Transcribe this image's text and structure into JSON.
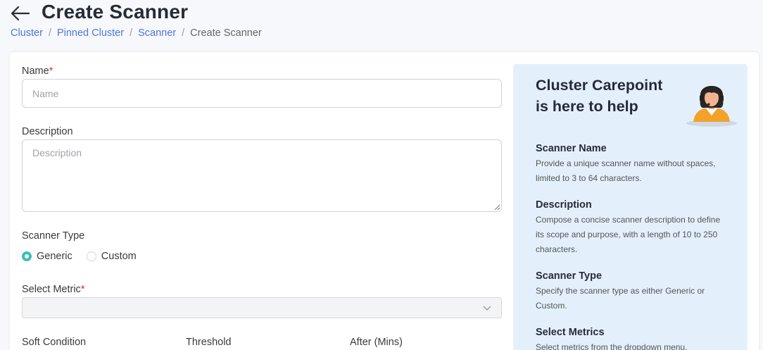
{
  "header": {
    "title": "Create Scanner",
    "breadcrumb": [
      "Cluster",
      "Pinned Cluster",
      "Scanner"
    ],
    "breadcrumb_current": "Create Scanner"
  },
  "form": {
    "name": {
      "label": "Name",
      "required": "*",
      "placeholder": "Name",
      "value": ""
    },
    "description": {
      "label": "Description",
      "placeholder": "Description",
      "value": ""
    },
    "scanner_type": {
      "label": "Scanner Type",
      "options": [
        "Generic",
        "Custom"
      ],
      "selected": "Generic"
    },
    "select_metric": {
      "label": "Select Metric",
      "required": "*",
      "value": ""
    },
    "columns": [
      "Soft Condition",
      "Threshold",
      "After (Mins)"
    ]
  },
  "help": {
    "title": "Cluster Carepoint is here to help",
    "sections": [
      {
        "heading": "Scanner Name",
        "text": "Provide a unique scanner name without spaces, limited to 3 to 64 characters."
      },
      {
        "heading": "Description",
        "text": "Compose a concise scanner description to define its scope and purpose, with a length of 10 to 250 characters."
      },
      {
        "heading": "Scanner Type",
        "text": "Specify the scanner type as either Generic or Custom."
      },
      {
        "heading": "Select Metrics",
        "text": "Select metrics from the dropdown menu."
      }
    ]
  },
  "colors": {
    "accent": "#3fbfb0",
    "link": "#4a78d8",
    "required": "#d3312b",
    "help_bg": "#e3f0fc"
  }
}
